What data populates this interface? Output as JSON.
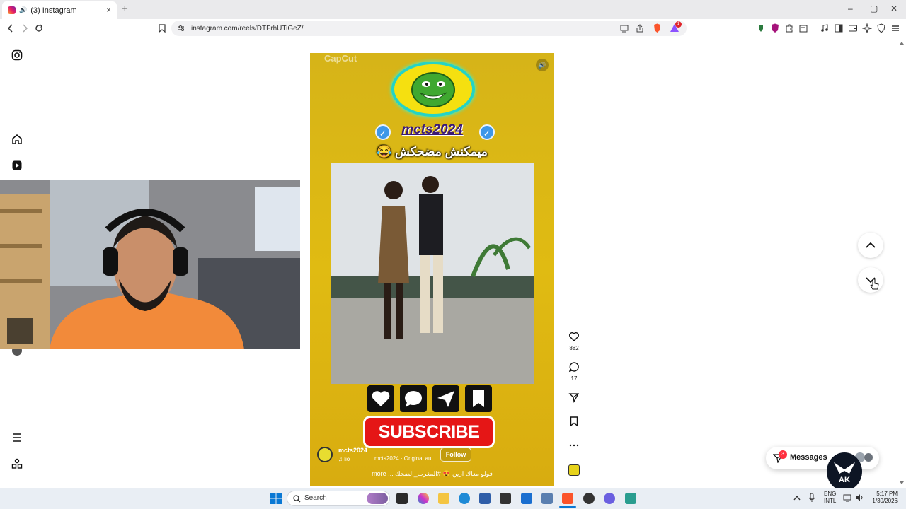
{
  "browser": {
    "tab_title": "(3) Instagram",
    "new_tab": "+",
    "close_tab": "×",
    "url": "instagram.com/reels/DTFrhUTiGeZ/",
    "window_controls": [
      "–",
      "▢",
      "✕"
    ],
    "brave_badge": "1"
  },
  "sidebar": {
    "icons": [
      "instagram-icon",
      "home-icon",
      "reels-icon",
      "more-menu-icon",
      "also-from-meta-icon"
    ]
  },
  "reel": {
    "watermark": "CapCut",
    "channel_name": "mcts2024",
    "caption_arabic": "ميمكنش مضحكش 😂",
    "subscribe_label": "SUBSCRIBE",
    "username": "mcts2024",
    "audio": "♫ lio",
    "audio_original": "mcts2024 · Original au",
    "follow_label": "Follow",
    "description": "فولو معاك ازين 😍 #المغرب_الضحك ... more"
  },
  "actions": {
    "likes": "882",
    "comments": "17"
  },
  "messages": {
    "label": "Messages",
    "badge": "3"
  },
  "taskbar": {
    "search_placeholder": "Search",
    "lang_top": "ENG",
    "lang_bottom": "INTL",
    "time": "5:17 PM",
    "date": "1/30/2026",
    "streamer_logo_text": "AK"
  },
  "colors": {
    "reel_background": "#d8b215",
    "subscribe_red": "#e51616",
    "verified_blue": "#3d97e8",
    "notification_red": "#ff3040"
  }
}
